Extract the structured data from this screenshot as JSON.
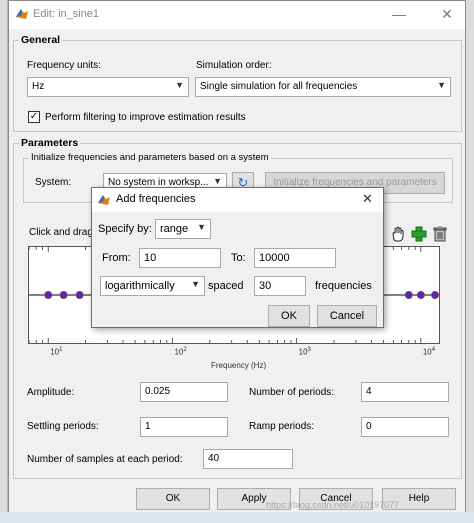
{
  "window": {
    "title": "Edit: in_sine1",
    "minimize_glyph": "—",
    "close_glyph": "✕"
  },
  "general": {
    "group_label": "General",
    "frequency_units_label": "Frequency units:",
    "frequency_units_value": "Hz",
    "simulation_order_label": "Simulation order:",
    "simulation_order_value": "Single simulation for all frequencies",
    "filtering_label": "Perform filtering to improve estimation results",
    "filtering_checked": "✓"
  },
  "parameters": {
    "group_label": "Parameters",
    "init_group_label": "Initialize frequencies and parameters based on a system",
    "system_label": "System:",
    "system_value": "No system in worksp...",
    "init_button_label": "Initialize frequencies and parameters",
    "click_drag_text": "Click and drag t",
    "amplitude_label": "Amplitude:",
    "amplitude_value": "0.025",
    "num_periods_label": "Number of periods:",
    "num_periods_value": "4",
    "settling_label": "Settling periods:",
    "settling_value": "1",
    "ramp_label": "Ramp periods:",
    "ramp_value": "0",
    "samples_label": "Number of samples at each period:",
    "samples_value": "40"
  },
  "plot": {
    "xlabel": "Frequency (Hz)",
    "tick_base": "10",
    "tick_exponents": [
      "1",
      "2",
      "3",
      "4"
    ]
  },
  "chart_data": {
    "type": "scatter",
    "xlabel": "Frequency (Hz)",
    "x_scale": "log",
    "xlim": [
      7,
      14000
    ],
    "x": [
      10,
      13.3,
      17.9,
      8000,
      10000,
      13000
    ],
    "y": [
      0,
      0,
      0,
      0,
      0,
      0
    ],
    "grid": false
  },
  "dialog": {
    "title": "Add frequencies",
    "close_glyph": "✕",
    "specify_by_label": "Specify by:",
    "specify_by_value": "range",
    "from_label": "From:",
    "from_value": "10",
    "to_label": "To:",
    "to_value": "10000",
    "spacing_value": "logarithmically",
    "spaced_label": "spaced",
    "count_value": "30",
    "frequencies_label": "frequencies",
    "ok_label": "OK",
    "cancel_label": "Cancel"
  },
  "footer": {
    "ok_label": "OK",
    "apply_label": "Apply",
    "cancel_label": "Cancel",
    "help_label": "Help",
    "watermark": "https://blog.csdn.net/u010197077"
  },
  "colors": {
    "marker_fill": "#3b33c4",
    "marker_edge": "#c03030",
    "matlab_orange": "#e07b1a",
    "add_green": "#2e9e2e"
  }
}
